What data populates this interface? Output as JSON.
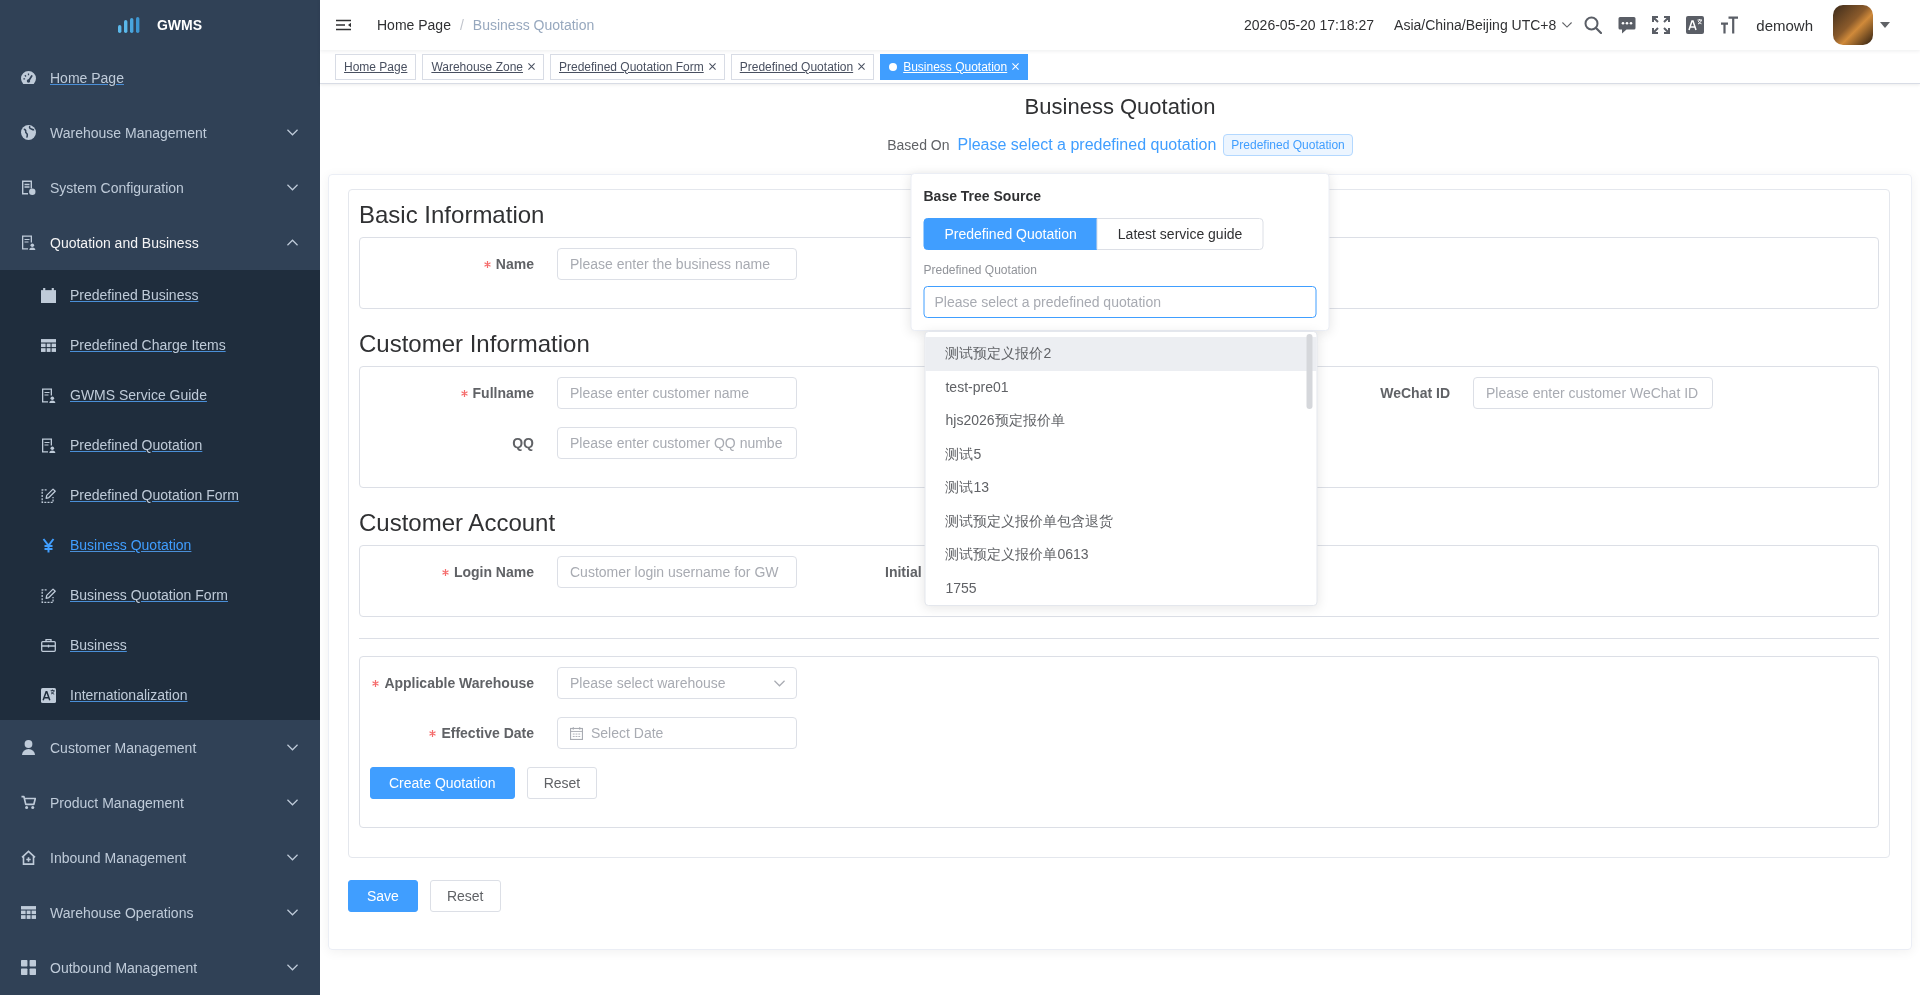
{
  "sidebar": {
    "logo_title": "GWMS",
    "items": [
      {
        "kind": "link",
        "label": "Home Page"
      },
      {
        "kind": "group",
        "label": "Warehouse Management",
        "expanded": false
      },
      {
        "kind": "group",
        "label": "System Configuration",
        "expanded": false
      },
      {
        "kind": "group",
        "label": "Quotation and Business",
        "expanded": true,
        "children": [
          {
            "label": "Predefined Business",
            "selected": false
          },
          {
            "label": "Predefined Charge Items",
            "selected": false
          },
          {
            "label": "GWMS Service Guide",
            "selected": false
          },
          {
            "label": "Predefined Quotation",
            "selected": false
          },
          {
            "label": "Predefined Quotation Form",
            "selected": false
          },
          {
            "label": "Business Quotation",
            "selected": true
          },
          {
            "label": "Business Quotation Form",
            "selected": false
          },
          {
            "label": "Business",
            "selected": false
          },
          {
            "label": "Internationalization",
            "selected": false
          }
        ]
      },
      {
        "kind": "group",
        "label": "Customer Management",
        "expanded": false
      },
      {
        "kind": "group",
        "label": "Product Management",
        "expanded": false
      },
      {
        "kind": "group",
        "label": "Inbound Management",
        "expanded": false
      },
      {
        "kind": "group",
        "label": "Warehouse Operations",
        "expanded": false
      },
      {
        "kind": "group",
        "label": "Outbound Management",
        "expanded": false
      }
    ]
  },
  "navbar": {
    "breadcrumb": {
      "separator": "/",
      "items": [
        {
          "label": "Home Page",
          "current": false
        },
        {
          "label": "Business Quotation",
          "current": true
        }
      ]
    },
    "datetime": "2026-05-20 17:18:27",
    "timezone": "Asia/China/Beijing UTC+8",
    "user": "demowh"
  },
  "tags": [
    {
      "label": "Home Page",
      "selected": false,
      "closable": false
    },
    {
      "label": "Warehouse Zone",
      "selected": false,
      "closable": true
    },
    {
      "label": "Predefined Quotation Form",
      "selected": false,
      "closable": true
    },
    {
      "label": "Predefined Quotation",
      "selected": false,
      "closable": true
    },
    {
      "label": "Business Quotation",
      "selected": true,
      "closable": true
    }
  ],
  "page": {
    "title": "Business Quotation",
    "based_on": {
      "label": "Based On",
      "link": "Please select a predefined quotation",
      "tag": "Predefined Quotation"
    }
  },
  "popover": {
    "title": "Base Tree Source",
    "options": [
      {
        "label": "Predefined Quotation",
        "selected": true
      },
      {
        "label": "Latest service guide",
        "selected": false
      }
    ],
    "field": {
      "label": "Predefined Quotation",
      "placeholder": "Please select a predefined quotation",
      "focused": true,
      "dropdown": {
        "options": [
          {
            "label": "测试预定义报价2",
            "hovered": true
          },
          {
            "label": "test-pre01",
            "hovered": false
          },
          {
            "label": "hjs2026预定报价单",
            "hovered": false
          },
          {
            "label": "测试5",
            "hovered": false
          },
          {
            "label": "测试13",
            "hovered": false
          },
          {
            "label": "测试预定义报价单包含退货",
            "hovered": false
          },
          {
            "label": "测试预定义报价单0613",
            "hovered": false
          },
          {
            "label": "1755",
            "hovered": false
          }
        ]
      }
    }
  },
  "form": {
    "sections": [
      {
        "title": "Basic Information",
        "columns": {
          "left": [
            {
              "label": "Name",
              "kind": "text",
              "required": true,
              "placeholder": "Please enter the business name"
            }
          ]
        }
      },
      {
        "title": "Customer Information",
        "columns": {
          "left": [
            {
              "label": "Fullname",
              "kind": "text",
              "required": true,
              "placeholder": "Please enter customer name"
            },
            {
              "label": "QQ",
              "kind": "text",
              "required": false,
              "placeholder": "Please enter customer QQ numbe"
            }
          ],
          "right": [
            {
              "label": "WeChat ID",
              "kind": "text",
              "required": false,
              "placeholder": "Please enter customer WeChat ID"
            }
          ]
        }
      },
      {
        "title": "Customer Account",
        "columns": {
          "left": [
            {
              "label": "Login Name",
              "kind": "text",
              "required": true,
              "placeholder": "Customer login username for GW"
            }
          ],
          "middle": [
            {
              "label": "Initial",
              "required": false
            }
          ]
        }
      },
      {
        "divider_before": true,
        "columns": {
          "left": [
            {
              "label": "Applicable Warehouse",
              "kind": "select",
              "required": true,
              "placeholder": "Please select warehouse"
            },
            {
              "label": "Effective Date",
              "kind": "date",
              "required": true,
              "placeholder": "Select Date"
            }
          ]
        },
        "buttons": [
          {
            "label": "Create Quotation",
            "kind": "primary"
          },
          {
            "label": "Reset",
            "kind": "default"
          }
        ]
      }
    ],
    "actions": [
      {
        "label": "Save",
        "kind": "primary"
      },
      {
        "label": "Reset",
        "kind": "default"
      }
    ]
  }
}
